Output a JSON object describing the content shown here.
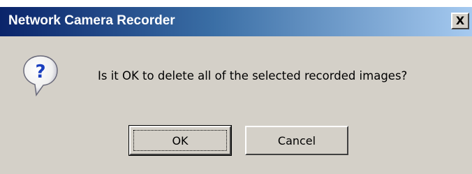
{
  "window": {
    "title": "Network Camera Recorder",
    "close_label": "X"
  },
  "message": {
    "icon": "question-icon",
    "text": "Is it OK to delete all of the selected recorded images?"
  },
  "buttons": {
    "ok_label": "OK",
    "cancel_label": "Cancel"
  },
  "colors": {
    "titlebar_start": "#0a246a",
    "titlebar_end": "#a6caf0",
    "dialog_bg": "#d4d0c8"
  }
}
